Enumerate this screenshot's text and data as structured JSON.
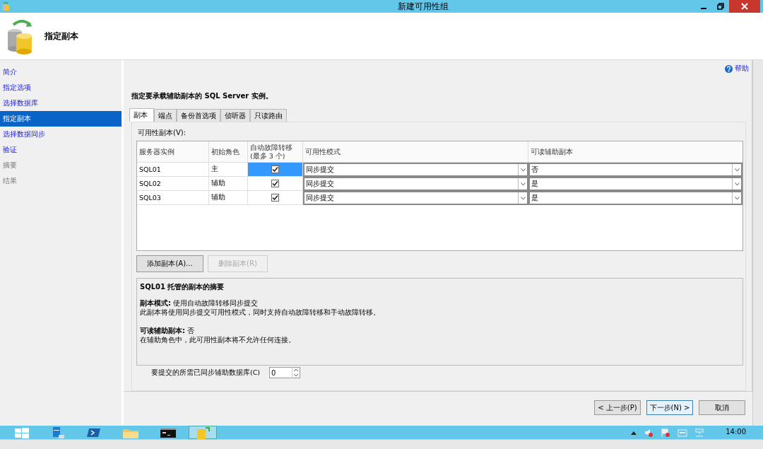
{
  "window": {
    "title": "新建可用性组"
  },
  "header": {
    "title": "指定副本"
  },
  "sidebar": {
    "items": [
      {
        "label": "简介",
        "selected": false,
        "disabled": false
      },
      {
        "label": "指定选项",
        "selected": false,
        "disabled": false
      },
      {
        "label": "选择数据库",
        "selected": false,
        "disabled": false
      },
      {
        "label": "指定副本",
        "selected": true,
        "disabled": false
      },
      {
        "label": "选择数据同步",
        "selected": false,
        "disabled": false
      },
      {
        "label": "验证",
        "selected": false,
        "disabled": false
      },
      {
        "label": "摘要",
        "selected": false,
        "disabled": true
      },
      {
        "label": "结果",
        "selected": false,
        "disabled": true
      }
    ]
  },
  "help": "帮助",
  "instruction": "指定要承载辅助副本的 SQL Server 实例。",
  "tabs": [
    {
      "label": "副本",
      "selected": true
    },
    {
      "label": "端点",
      "selected": false
    },
    {
      "label": "备份首选项",
      "selected": false
    },
    {
      "label": "侦听器",
      "selected": false
    },
    {
      "label": "只读路由",
      "selected": false
    }
  ],
  "replicas_label": "可用性副本(V):",
  "table": {
    "columns": [
      "服务器实例",
      "初始角色",
      "自动故障转移(最多 3 个)",
      "可用性模式",
      "可读辅助副本"
    ],
    "rows": [
      {
        "server": "SQL01",
        "role": "主",
        "auto_failover": true,
        "mode": "同步提交",
        "readable": "否",
        "selected": true
      },
      {
        "server": "SQL02",
        "role": "辅助",
        "auto_failover": true,
        "mode": "同步提交",
        "readable": "是",
        "selected": false
      },
      {
        "server": "SQL03",
        "role": "辅助",
        "auto_failover": true,
        "mode": "同步提交",
        "readable": "是",
        "selected": false
      }
    ]
  },
  "buttons": [
    {
      "label": "添加副本(A)...",
      "disabled": false
    },
    {
      "label": "删除副本(R)",
      "disabled": true
    }
  ],
  "summary": {
    "title": "SQL01 托管的副本的摘要",
    "sections": [
      [
        "**副本模式:** 使用自动故障转移同步提交",
        "此副本将使用同步提交可用性模式，同时支持自动故障转移和手动故障转移。"
      ],
      [
        "**可读辅助副本:** 否",
        "在辅助角色中，此可用性副本将不允许任何连接。"
      ]
    ]
  },
  "sync_required": {
    "label": "要提交的所需已同步辅助数据库(C)",
    "value": "0"
  },
  "nav_buttons": [
    {
      "label": "< 上一步(P)",
      "focused": false
    },
    {
      "label": "下一步(N) >",
      "focused": true
    },
    {
      "label": "取消",
      "focused": false
    }
  ],
  "taskbar": {
    "time": "14:00"
  }
}
